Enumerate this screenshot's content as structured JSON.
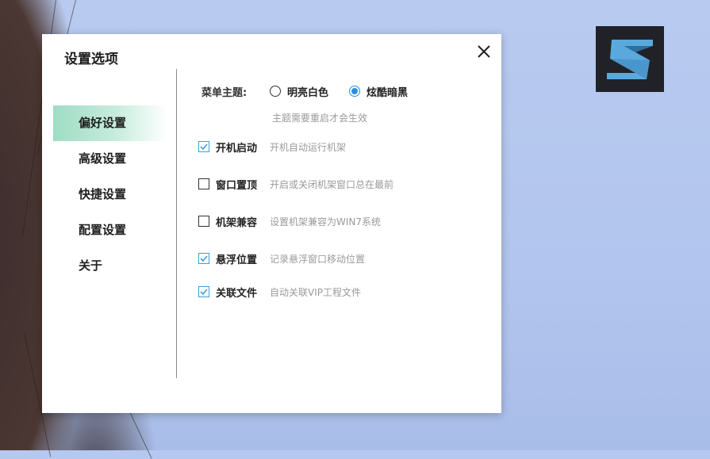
{
  "dialog": {
    "title": "设置选项"
  },
  "sidebar": {
    "items": [
      {
        "label": "偏好设置",
        "active": true
      },
      {
        "label": "高级设置",
        "active": false
      },
      {
        "label": "快捷设置",
        "active": false
      },
      {
        "label": "配置设置",
        "active": false
      },
      {
        "label": "关于",
        "active": false
      }
    ]
  },
  "theme": {
    "label": "菜单主题:",
    "options": [
      {
        "label": "明亮白色",
        "selected": false
      },
      {
        "label": "炫酷暗黑",
        "selected": true
      }
    ],
    "hint": "主题需要重启才会生效"
  },
  "options": [
    {
      "label": "开机启动",
      "desc": "开机自动运行机架",
      "checked": true
    },
    {
      "label": "窗口置顶",
      "desc": "开启或关闭机架窗口总在最前",
      "checked": false
    },
    {
      "label": "机架兼容",
      "desc": "设置机架兼容为WIN7系统",
      "checked": false
    },
    {
      "label": "悬浮位置",
      "desc": "记录悬浮窗口移动位置",
      "checked": true
    },
    {
      "label": "关联文件",
      "desc": "自动关联VIP工程文件",
      "checked": true
    }
  ],
  "colors": {
    "accent": "#2a8fe0",
    "nav_active": "#9fdcc4",
    "check": "#3aa0d8"
  },
  "icons": {
    "close": "close-icon",
    "logo": "app-logo-s",
    "check": "check-icon"
  }
}
